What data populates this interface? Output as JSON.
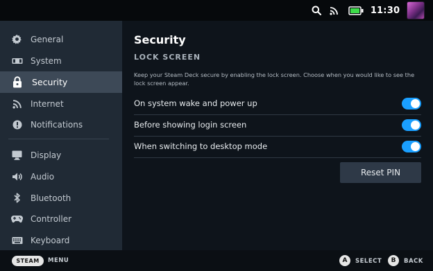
{
  "topbar": {
    "icons": [
      "search-icon",
      "wifi-icon",
      "battery-icon"
    ],
    "time": "11:30",
    "accent": "#3ddc4a"
  },
  "sidebar": {
    "items": [
      {
        "label": "General",
        "icon": "gear-icon"
      },
      {
        "label": "System",
        "icon": "system-icon"
      },
      {
        "label": "Security",
        "icon": "lock-icon",
        "active": true
      },
      {
        "label": "Internet",
        "icon": "wifi-icon"
      },
      {
        "label": "Notifications",
        "icon": "alert-icon"
      },
      {
        "label": "Display",
        "icon": "monitor-icon"
      },
      {
        "label": "Audio",
        "icon": "speaker-icon"
      },
      {
        "label": "Bluetooth",
        "icon": "bluetooth-icon"
      },
      {
        "label": "Controller",
        "icon": "gamepad-icon"
      },
      {
        "label": "Keyboard",
        "icon": "keyboard-icon"
      }
    ]
  },
  "main": {
    "title": "Security",
    "section": "LOCK SCREEN",
    "description": "Keep your Steam Deck secure by enabling the lock screen. Choose when you would like to see the lock screen appear.",
    "toggles": [
      {
        "label": "On system wake and power up",
        "on": true
      },
      {
        "label": "Before showing login screen",
        "on": true
      },
      {
        "label": "When switching to desktop mode",
        "on": true
      }
    ],
    "reset_label": "Reset PIN",
    "toggle_color": "#1a9fff"
  },
  "footer": {
    "steam_label": "STEAM",
    "menu_label": "MENU",
    "a_key": "A",
    "select_label": "SELECT",
    "b_key": "B",
    "back_label": "BACK"
  }
}
